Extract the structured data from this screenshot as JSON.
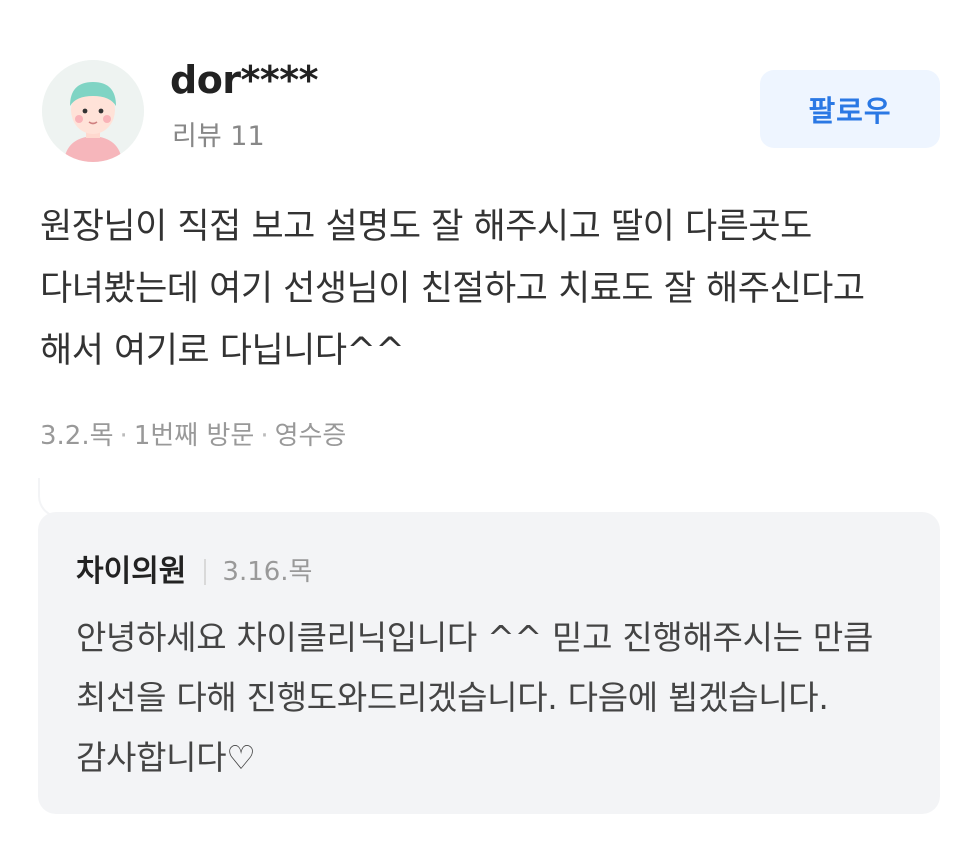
{
  "review": {
    "user_name": "dor****",
    "review_count": "리뷰 11",
    "follow_label": "팔로우",
    "text": "원장님이 직접 보고 설명도 잘 해주시고 딸이 다른곳도 다녀봤는데 여기 선생님이 친절하고 치료도 잘 해주신다고 해서 여기로 다닙니다^^",
    "meta": {
      "date": "3.2.목",
      "visit": "1번째 방문",
      "receipt": "영수증"
    }
  },
  "reply": {
    "author": "차이의원",
    "date": "3.16.목",
    "text": "안녕하세요 차이클리닉입니다 ^^ 믿고 진행해주시는 만큼 최선을 다해 진행도와드리겠습니다. 다음에 뵙겠습니다. 감사합니다♡"
  },
  "icons": {
    "avatar": "user-avatar-icon"
  },
  "colors": {
    "accent": "#2a78e4",
    "follow_bg": "#eef5ff",
    "reply_bg": "#f3f4f6"
  }
}
